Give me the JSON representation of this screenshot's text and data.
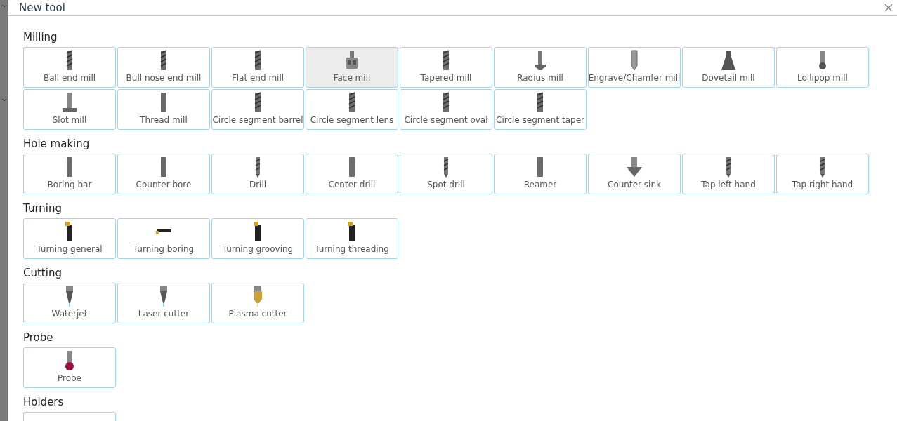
{
  "dialog": {
    "title": "New tool"
  },
  "sections": [
    {
      "title": "Milling",
      "items": [
        {
          "label": "Ball end mill",
          "selected": false
        },
        {
          "label": "Bull nose end mill",
          "selected": false
        },
        {
          "label": "Flat end mill",
          "selected": false
        },
        {
          "label": "Face mill",
          "selected": true
        },
        {
          "label": "Tapered mill",
          "selected": false
        },
        {
          "label": "Radius mill",
          "selected": false
        },
        {
          "label": "Engrave/Chamfer mill",
          "selected": false
        },
        {
          "label": "Dovetail mill",
          "selected": false
        },
        {
          "label": "Lollipop mill",
          "selected": false
        },
        {
          "label": "Slot mill",
          "selected": false
        },
        {
          "label": "Thread mill",
          "selected": false
        },
        {
          "label": "Circle segment barrel",
          "selected": false
        },
        {
          "label": "Circle segment lens",
          "selected": false
        },
        {
          "label": "Circle segment oval",
          "selected": false
        },
        {
          "label": "Circle segment taper",
          "selected": false
        }
      ]
    },
    {
      "title": "Hole making",
      "items": [
        {
          "label": "Boring bar",
          "selected": false
        },
        {
          "label": "Counter bore",
          "selected": false
        },
        {
          "label": "Drill",
          "selected": false
        },
        {
          "label": "Center drill",
          "selected": false
        },
        {
          "label": "Spot drill",
          "selected": false
        },
        {
          "label": "Reamer",
          "selected": false
        },
        {
          "label": "Counter sink",
          "selected": false
        },
        {
          "label": "Tap left hand",
          "selected": false
        },
        {
          "label": "Tap right hand",
          "selected": false
        }
      ]
    },
    {
      "title": "Turning",
      "items": [
        {
          "label": "Turning general",
          "selected": false
        },
        {
          "label": "Turning boring",
          "selected": false
        },
        {
          "label": "Turning grooving",
          "selected": false
        },
        {
          "label": "Turning threading",
          "selected": false
        }
      ]
    },
    {
      "title": "Cutting",
      "items": [
        {
          "label": "Waterjet",
          "selected": false
        },
        {
          "label": "Laser cutter",
          "selected": false
        },
        {
          "label": "Plasma cutter",
          "selected": false
        }
      ]
    },
    {
      "title": "Probe",
      "items": [
        {
          "label": "Probe",
          "selected": false
        }
      ]
    },
    {
      "title": "Holders",
      "items": [
        {
          "selected": false
        }
      ]
    }
  ]
}
